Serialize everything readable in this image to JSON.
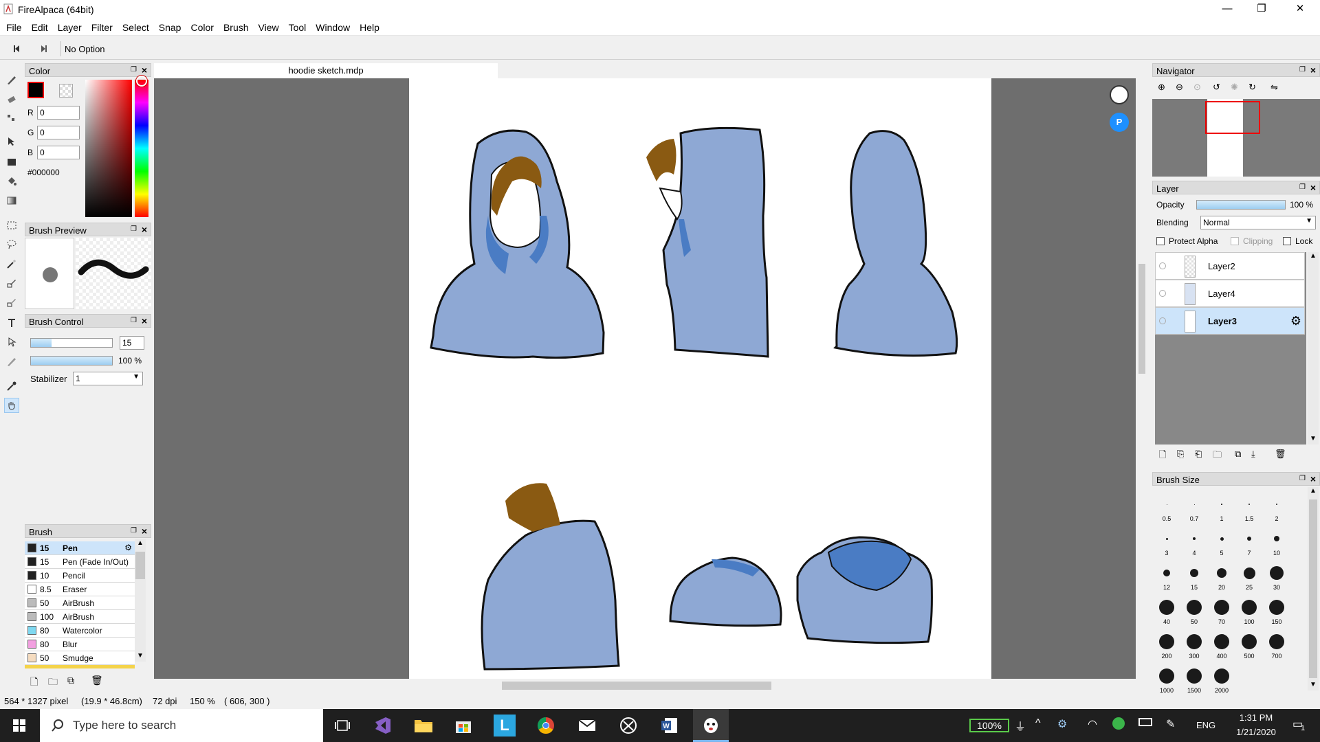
{
  "app": {
    "title": "FireAlpaca (64bit)"
  },
  "window_controls": {
    "minimize": "—",
    "maximize": "❐",
    "close": "✕"
  },
  "menu": [
    "File",
    "Edit",
    "Layer",
    "Filter",
    "Select",
    "Snap",
    "Color",
    "Brush",
    "View",
    "Tool",
    "Window",
    "Help"
  ],
  "options": {
    "text": "No Option"
  },
  "document": {
    "tab": "hoodie sketch.mdp"
  },
  "color_panel": {
    "title": "Color",
    "r_label": "R",
    "g_label": "G",
    "b_label": "B",
    "r": "0",
    "g": "0",
    "b": "0",
    "hex": "#000000",
    "primary": "#000000"
  },
  "brush_preview": {
    "title": "Brush Preview"
  },
  "brush_control": {
    "title": "Brush Control",
    "size": "15",
    "opacity": "100 %",
    "size_value": 15,
    "opacity_value": 100,
    "stabilizer_label": "Stabilizer",
    "stabilizer": "1"
  },
  "brush_panel": {
    "title": "Brush",
    "items": [
      {
        "size": "15",
        "name": "Pen",
        "color": "#222222",
        "selected": true
      },
      {
        "size": "15",
        "name": "Pen (Fade In/Out)",
        "color": "#222222"
      },
      {
        "size": "10",
        "name": "Pencil",
        "color": "#222222"
      },
      {
        "size": "8.5",
        "name": "Eraser",
        "color": "#ffffff"
      },
      {
        "size": "50",
        "name": "AirBrush",
        "color": "#bbbbbb"
      },
      {
        "size": "100",
        "name": "AirBrush",
        "color": "#bbbbbb"
      },
      {
        "size": "80",
        "name": "Watercolor",
        "color": "#7fd8f0"
      },
      {
        "size": "80",
        "name": "Blur",
        "color": "#f2a0e0"
      },
      {
        "size": "50",
        "name": "Smudge",
        "color": "#f5dcc0"
      }
    ]
  },
  "navigator": {
    "title": "Navigator"
  },
  "layer_panel": {
    "title": "Layer",
    "opacity_label": "Opacity",
    "opacity": "100 %",
    "opacity_value": 100,
    "blending_label": "Blending",
    "blending": "Normal",
    "protect_alpha": "Protect Alpha",
    "clipping": "Clipping",
    "lock": "Lock",
    "layers": [
      {
        "name": "Layer2"
      },
      {
        "name": "Layer4"
      },
      {
        "name": "Layer3",
        "selected": true
      }
    ]
  },
  "brush_size": {
    "title": "Brush Size",
    "sizes": [
      "0.5",
      "0.7",
      "1",
      "1.5",
      "2",
      "3",
      "4",
      "5",
      "7",
      "10",
      "12",
      "15",
      "20",
      "25",
      "30",
      "40",
      "50",
      "70",
      "100",
      "150",
      "200",
      "300",
      "400",
      "500",
      "700",
      "1000",
      "1500",
      "2000"
    ]
  },
  "status": {
    "dims": "564 * 1327 pixel",
    "cm": "(19.9 * 46.8cm)",
    "dpi": "72 dpi",
    "zoom": "150 %",
    "coords": "( 606, 300 )"
  },
  "taskbar": {
    "search_placeholder": "Type here to search",
    "battery": "100%",
    "lang": "ENG",
    "time": "1:31 PM",
    "date": "1/21/2020",
    "notifications": "1"
  },
  "colors": {
    "hood": "#8ea8d4",
    "hood_dark": "#4a7cc4",
    "hair": "#8a5a12",
    "accent": "#cde4fa"
  }
}
